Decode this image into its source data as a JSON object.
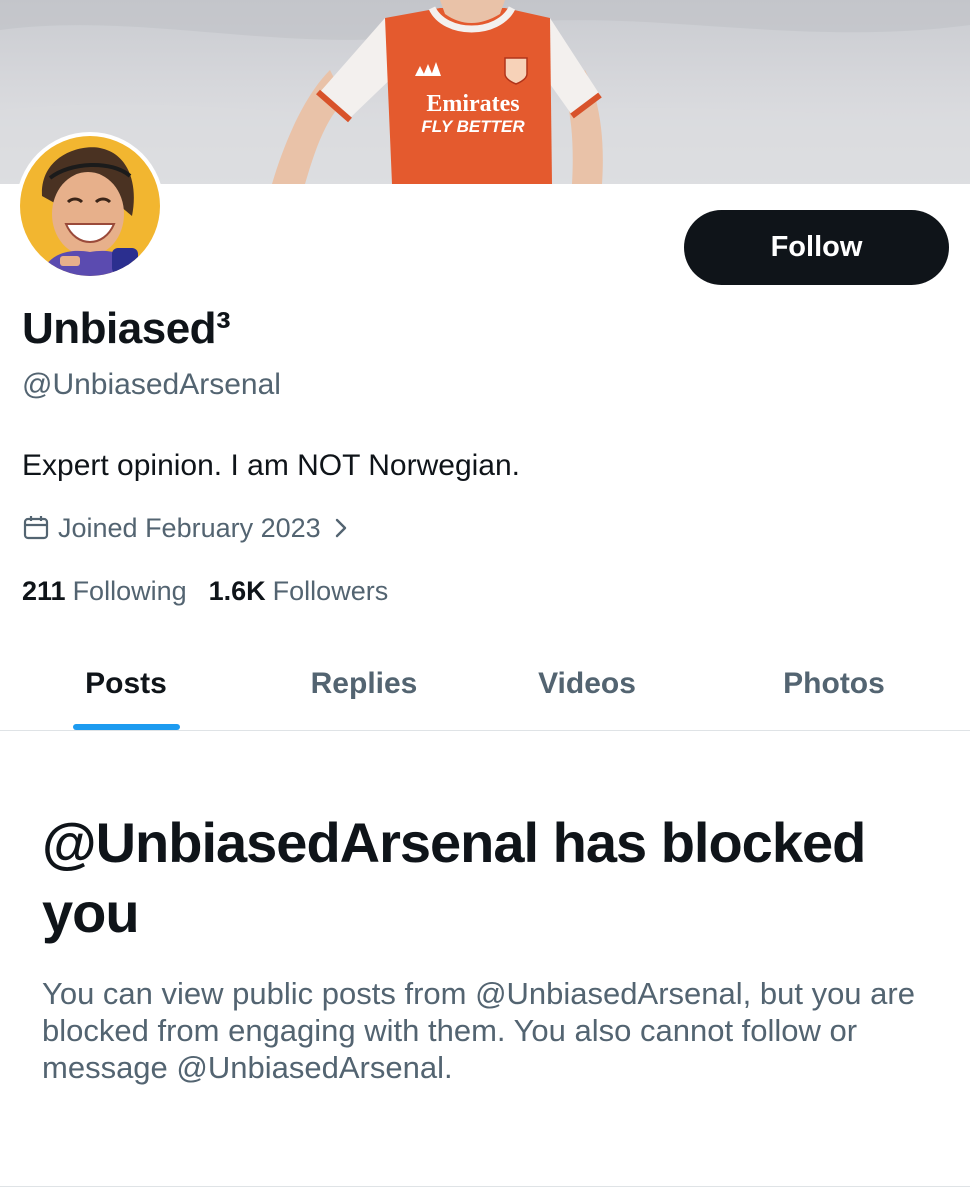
{
  "profile": {
    "display_name": "Unbiased³",
    "handle": "@UnbiasedArsenal",
    "bio": "Expert opinion. I am NOT Norwegian.",
    "joined": "Joined February 2023",
    "following_count": "211",
    "following_label": "Following",
    "followers_count": "1.6K",
    "followers_label": "Followers"
  },
  "banner": {
    "shirt_sponsor_line1": "Emirates",
    "shirt_sponsor_line2": "FLY BETTER"
  },
  "actions": {
    "follow_label": "Follow"
  },
  "tabs": [
    {
      "label": "Posts",
      "active": true
    },
    {
      "label": "Replies",
      "active": false
    },
    {
      "label": "Videos",
      "active": false
    },
    {
      "label": "Photos",
      "active": false
    }
  ],
  "blocked": {
    "title": "@UnbiasedArsenal has blocked you",
    "body": "You can view public posts from @UnbiasedArsenal, but you are blocked from engaging with them. You also cannot follow or message @UnbiasedArsenal."
  },
  "icons": {
    "calendar": "calendar-icon",
    "chevron": "chevron-right-icon"
  },
  "colors": {
    "accent": "#1d9bf0",
    "text_primary": "#0f1419",
    "text_secondary": "#536471",
    "button_bg": "#0f1419",
    "jersey": "#e45a2e"
  }
}
